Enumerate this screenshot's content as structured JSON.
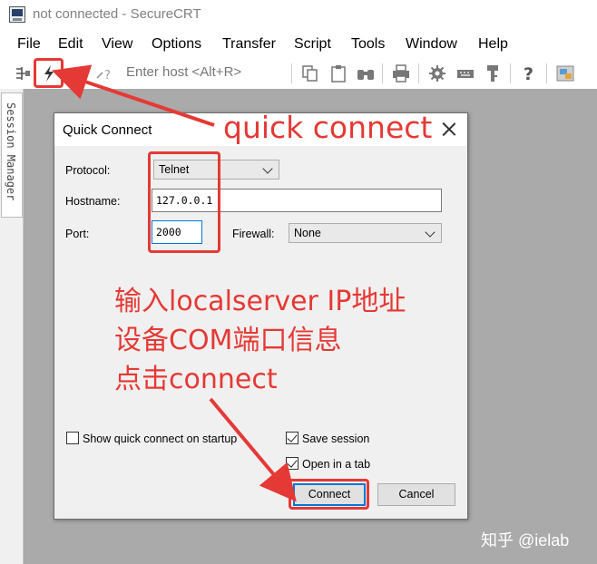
{
  "window": {
    "title": "not connected - SecureCRT"
  },
  "menubar": {
    "items": [
      "File",
      "Edit",
      "View",
      "Options",
      "Transfer",
      "Script",
      "Tools",
      "Window",
      "Help"
    ]
  },
  "toolbar": {
    "host_placeholder": "Enter host <Alt+R>",
    "icons": [
      "connect-tree-icon",
      "quick-connect-icon",
      "connect-tab-icon",
      "reconnect-icon",
      "copy-icon",
      "paste-icon",
      "find-icon",
      "print-icon",
      "settings-icon",
      "keymap-icon",
      "key-icon",
      "help-icon",
      "sftp-icon"
    ]
  },
  "side_panel": {
    "tab_label": "Session Manager"
  },
  "dialog": {
    "title": "Quick Connect",
    "protocol_label": "Protocol:",
    "protocol_value": "Telnet",
    "hostname_label": "Hostname:",
    "hostname_value": "127.0.0.1",
    "port_label": "Port:",
    "port_value": "2000",
    "firewall_label": "Firewall:",
    "firewall_value": "None",
    "show_on_startup_label": "Show quick connect on startup",
    "show_on_startup_checked": false,
    "save_session_label": "Save session",
    "save_session_checked": true,
    "open_in_tab_label": "Open in a tab",
    "open_in_tab_checked": true,
    "connect_label": "Connect",
    "cancel_label": "Cancel"
  },
  "annotations": {
    "quick_connect": "quick connect",
    "instructions": [
      "输入localserver IP地址",
      "设备COM端口信息",
      "点击connect"
    ],
    "color": "#e53935"
  },
  "watermark": "知乎 @ielab",
  "colors": {
    "workarea": "#aaaaaa",
    "dialog_bg": "#f0f0f0",
    "accent": "#0078d7",
    "annotation": "#e53935"
  }
}
